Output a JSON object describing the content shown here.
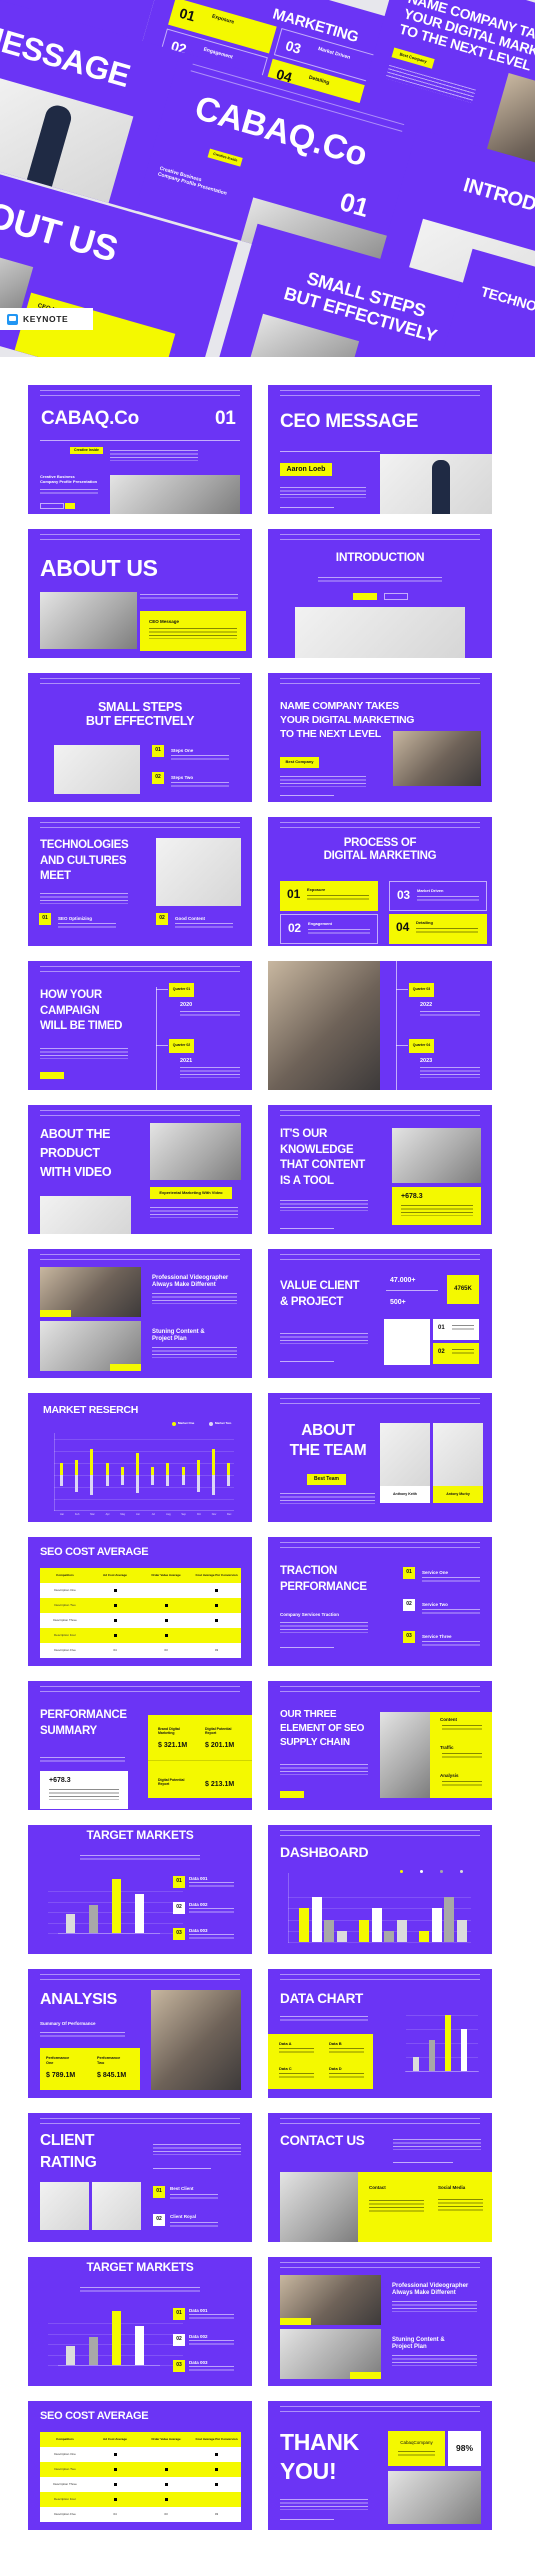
{
  "colors": {
    "purple": "#6b34f5",
    "yellow": "#f4f900",
    "white": "#ffffff",
    "gray": "#a8a8a8",
    "light_gray": "#dcdcdc"
  },
  "badge": {
    "icon": "keynote-icon",
    "label": "KEYNOTE"
  },
  "hero": {
    "cabaq_title": "CABAQ.Co",
    "cabaq_number": "01",
    "cabaq_badge": "Creative Inside",
    "cabaq_subtitle": "Creative Business\nCompany Profile Presentation",
    "ceo_title": "CEO MESSAGE",
    "about_title": "ABOUT US",
    "about_card": "CEO Message",
    "process_title": "MARKETING",
    "process_steps": [
      {
        "number": "01",
        "label": "Exposure"
      },
      {
        "number": "02",
        "label": "Engagement"
      },
      {
        "number": "03",
        "label": "Market Driven"
      },
      {
        "number": "04",
        "label": "Detailing"
      }
    ],
    "name_title": "NAME COMPANY TAKES\nYOUR DIGITAL MARKETING\nTO THE NEXT LEVEL",
    "name_badge": "Best Company",
    "intro_title": "INTRODUCTION",
    "steps_title": "SMALL STEPS\nBUT EFFECTIVELY",
    "tech_title": "TECHNOLOGIES"
  },
  "slides": [
    {
      "title": "CABAQ.Co",
      "number": "01",
      "badge": "Creative Inside",
      "subtitle": "Creative Business\nCompany Profile Presentation"
    },
    {
      "title": "CEO MESSAGE",
      "name": "Aaron Loeb"
    },
    {
      "title": "ABOUT US",
      "card_title": "CEO Message"
    },
    {
      "title": "INTRODUCTION"
    },
    {
      "title": "SMALL STEPS\nBUT EFFECTIVELY",
      "items": [
        {
          "number": "01",
          "label": "Steps One"
        },
        {
          "number": "02",
          "label": "Steps Two"
        }
      ]
    },
    {
      "title": "NAME COMPANY TAKES\nYOUR DIGITAL MARKETING\nTO THE NEXT LEVEL",
      "badge": "Best Company"
    },
    {
      "title": "TECHNOLOGIES\nAND CULTURES\nMEET",
      "items": [
        {
          "number": "01",
          "label": "SEO Optimizing"
        },
        {
          "number": "02",
          "label": "Good Content"
        }
      ]
    },
    {
      "title": "PROCESS OF\nDIGITAL MARKETING",
      "steps": [
        {
          "number": "01",
          "label": "Exposure"
        },
        {
          "number": "03",
          "label": "Market Driven"
        },
        {
          "number": "02",
          "label": "Engagement"
        },
        {
          "number": "04",
          "label": "Detailing"
        }
      ]
    },
    {
      "title": "HOW YOUR\nCAMPAIGN\nWILL BE TIMED",
      "milestones": [
        {
          "quarter": "Quarter 01",
          "year": "2020"
        },
        {
          "quarter": "Quarter 02",
          "year": "2021"
        }
      ]
    },
    {
      "milestones": [
        {
          "quarter": "Quarter 03",
          "year": "2022"
        },
        {
          "quarter": "Quarter 04",
          "year": "2023"
        }
      ]
    },
    {
      "title": "ABOUT THE\nPRODUCT\nWITH VIDEO",
      "badge": "Experiental Marketing With Video"
    },
    {
      "title": "IT'S OUR\nKNOWLEDGE\nTHAT CONTENT\nIS A TOOL",
      "stat": "+678.3"
    },
    {
      "heading_one": "Professional Videographer\nAlways Make Different",
      "heading_two": "Stuning Content &\nProject Plan"
    },
    {
      "title": "VALUE CLIENT\n& PROJECT",
      "stat_one": "47.000+",
      "stat_two": "500+",
      "highlight": "4765K",
      "items": [
        "01",
        "02"
      ]
    },
    {
      "title": "MARKET RESERCH",
      "chart": {
        "type": "bar",
        "categories": [
          "Jan",
          "Feb",
          "Mar",
          "Apr",
          "May",
          "Jun",
          "Jul",
          "Aug",
          "Sep",
          "Oct",
          "Nov",
          "Dec"
        ],
        "ylim": [
          -2,
          3
        ],
        "series": [
          {
            "name": "Market One",
            "color": "#f4f900",
            "values": [
              1.0,
              1.25,
              2.2,
              1.0,
              0.7,
              1.8,
              0.7,
              1.0,
              0.7,
              1.25,
              2.2,
              1.0
            ]
          },
          {
            "name": "Market Two",
            "color": "#dcd6f5",
            "values": [
              -0.95,
              -1.4,
              -1.7,
              -0.95,
              -0.8,
              -1.5,
              -0.8,
              -0.95,
              -0.8,
              -1.4,
              -1.7,
              -0.95
            ]
          }
        ]
      }
    },
    {
      "title": "ABOUT\nTHE TEAM",
      "badge": "Best Team",
      "members": [
        "Anthony Keith",
        "Antony Murby"
      ]
    },
    {
      "title": "SEO COST AVERAGE",
      "table": {
        "headers": [
          "Competitors",
          "Ad Cost Average",
          "Order Value Average",
          "Cost Average Per Conversion"
        ],
        "rows": [
          [
            "Description One",
            true,
            false,
            true
          ],
          [
            "Description Two",
            true,
            true,
            true
          ],
          [
            "Description Three",
            true,
            true,
            true
          ],
          [
            "Description Four",
            true,
            true,
            false
          ],
          [
            "Description Five",
            "04",
            "03",
            "03"
          ]
        ]
      }
    },
    {
      "title": "TRACTION\nPERFORMANCE",
      "subtitle": "Company Services Traction",
      "items": [
        {
          "number": "01",
          "label": "Service One"
        },
        {
          "number": "02",
          "label": "Service Two"
        },
        {
          "number": "03",
          "label": "Service Three"
        }
      ]
    },
    {
      "title": "PERFORMANCE\nSUMMARY",
      "stat": "+678.3",
      "metrics": [
        {
          "label": "Brand Digital\nMarketing",
          "value": "$ 321.1M"
        },
        {
          "label": "Digital Potential\nReport",
          "value": "$ 201.1M"
        },
        {
          "label": "Digital Potential\nReport",
          "value": "$ 213.1M"
        }
      ]
    },
    {
      "title": "OUR THREE\nELEMENT OF SEO\nSUPPLY CHAIN",
      "elements": [
        "Content",
        "Traffic",
        "Analysis"
      ]
    },
    {
      "title": "TARGET MARKETS",
      "chart": {
        "type": "bar",
        "values": [
          35,
          52,
          100,
          72
        ],
        "colors": [
          "#dcdcdc",
          "#a8a8a8",
          "#f4f900",
          "#ffffff"
        ]
      },
      "items": [
        {
          "number": "01",
          "label": "Data 001"
        },
        {
          "number": "02",
          "label": "Data 002"
        },
        {
          "number": "03",
          "label": "Data 003"
        }
      ]
    },
    {
      "title": "DASHBOARD",
      "chart": {
        "type": "bar",
        "ylim": [
          0,
          100
        ],
        "colors": [
          "#f4f900",
          "#ffffff",
          "#a8a8a8",
          "#dcdcdc"
        ],
        "groups": [
          [
            75,
            100,
            50,
            25
          ],
          [
            50,
            75,
            25,
            50
          ],
          [
            25,
            75,
            100,
            50
          ]
        ]
      }
    },
    {
      "title": "ANALYSIS",
      "subtitle": "Summary Of Performance",
      "metrics": [
        {
          "label": "Performance\nOne",
          "value": "$ 789.1M"
        },
        {
          "label": "Performance\nTwo",
          "value": "$ 845.1M"
        }
      ]
    },
    {
      "title": "DATA CHART",
      "items": [
        "Data A",
        "Data B",
        "Data C",
        "Data D"
      ],
      "chart": {
        "type": "bar",
        "values": [
          25,
          56,
          100,
          75
        ],
        "colors": [
          "#dcdcdc",
          "#a8a8a8",
          "#f4f900",
          "#ffffff"
        ]
      }
    },
    {
      "title": "CLIENT\nRATING",
      "items": [
        {
          "number": "01",
          "label": "Best Client"
        },
        {
          "number": "02",
          "label": "Client Royal"
        }
      ]
    },
    {
      "title": "CONTACT US",
      "contact_label": "Contact",
      "social_label": "Social Media"
    },
    {
      "title": "TARGET MARKETS",
      "chart": {
        "type": "bar",
        "values": [
          35,
          52,
          100,
          72
        ],
        "colors": [
          "#dcdcdc",
          "#a8a8a8",
          "#f4f900",
          "#ffffff"
        ]
      },
      "items": [
        {
          "number": "01",
          "label": "Data 001"
        },
        {
          "number": "02",
          "label": "Data 002"
        },
        {
          "number": "03",
          "label": "Data 003"
        }
      ]
    },
    {
      "heading_one": "Professional Videographer\nAlways Make Different",
      "heading_two": "Stuning Content &\nProject Plan"
    },
    {
      "title": "SEO COST AVERAGE",
      "table": {
        "headers": [
          "Competitors",
          "Ad Cost Average",
          "Order Value Average",
          "Cost Average Per Conversion"
        ],
        "rows": [
          [
            "Description One",
            true,
            false,
            true
          ],
          [
            "Description Two",
            true,
            true,
            true
          ],
          [
            "Description Three",
            true,
            true,
            true
          ],
          [
            "Description Four",
            true,
            true,
            false
          ],
          [
            "Description Five",
            "04",
            "03",
            "03"
          ]
        ]
      }
    },
    {
      "title": "THANK\nYOU!",
      "company": "CabaqCompany",
      "stat": "98%"
    }
  ]
}
